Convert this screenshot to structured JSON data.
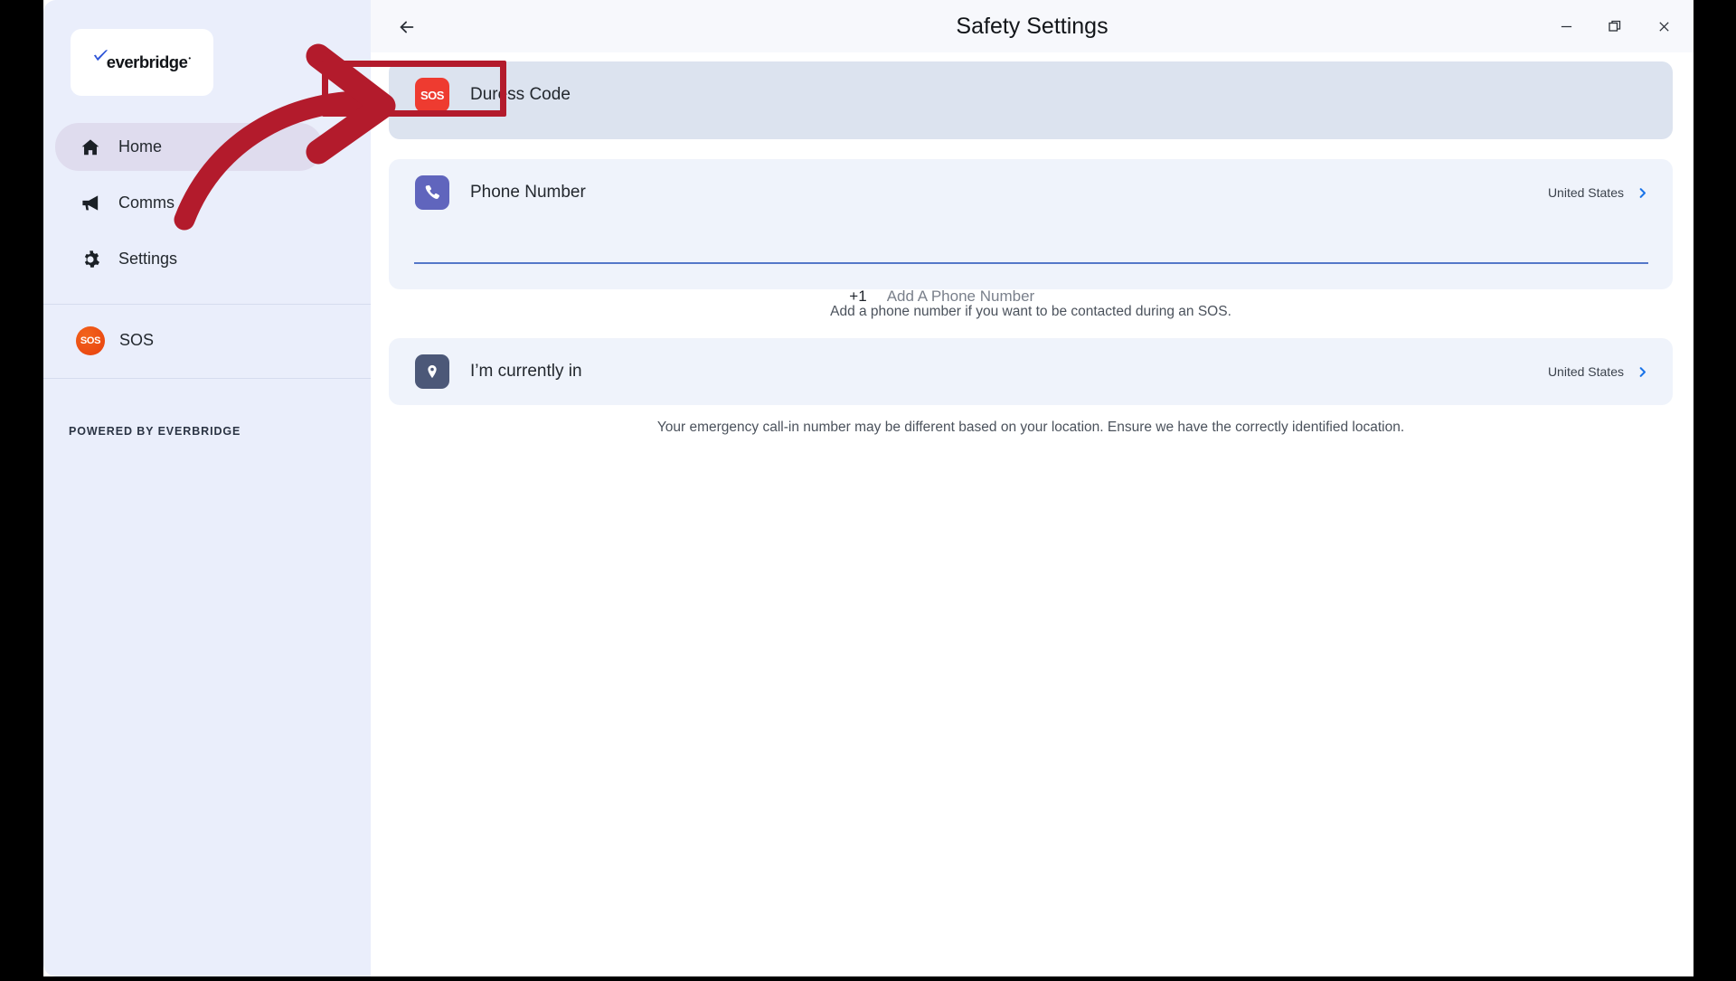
{
  "window": {
    "title": "Safety Settings",
    "back_icon": "back-arrow-icon",
    "controls": {
      "minimize": "minimize-icon",
      "maximize": "restore-window-icon",
      "close": "close-icon"
    }
  },
  "sidebar": {
    "logo": {
      "text": "everbridge",
      "trademark": "™",
      "check_color": "#2f56d8"
    },
    "items": [
      {
        "label": "Home",
        "icon": "home-icon",
        "active": true
      },
      {
        "label": "Comms",
        "icon": "megaphone-icon",
        "active": false
      },
      {
        "label": "Settings",
        "icon": "gear-icon",
        "active": false
      }
    ],
    "sos": {
      "label": "SOS",
      "icon": "sos-circle-icon",
      "badge_text": "SOS"
    },
    "footer": "POWERED BY EVERBRIDGE"
  },
  "main": {
    "duress": {
      "label": "Duress Code",
      "icon": "sos-badge-icon",
      "badge_text": "SOS",
      "highlighted": true
    },
    "phone": {
      "label": "Phone Number",
      "icon": "phone-icon",
      "country": "United States",
      "chevron": "chevron-right-icon",
      "prefix": "+1",
      "value": "",
      "placeholder": "Add A Phone Number",
      "helper": "Add a phone number if you want to be contacted during an SOS."
    },
    "location": {
      "label": "I’m currently in",
      "icon": "location-pin-icon",
      "country": "United States",
      "chevron": "chevron-right-icon",
      "helper": "Your emergency call-in number may be different based on your location. Ensure we have the correctly identified location."
    }
  },
  "annotation": {
    "arrow": "curved-red-arrow",
    "arrow_color": "#b31b2c",
    "highlight_color": "#b31b2c"
  },
  "colors": {
    "sidebar_bg": "#eaeefb",
    "card_bg": "#eff3fb",
    "card_highlight_bg": "#dce3ef",
    "accent_blue": "#1a73e8",
    "sos_red": "#ee3b30",
    "sos_orange": "#e8400e",
    "phone_purple": "#6065bd",
    "place_slate": "#4c5878"
  }
}
